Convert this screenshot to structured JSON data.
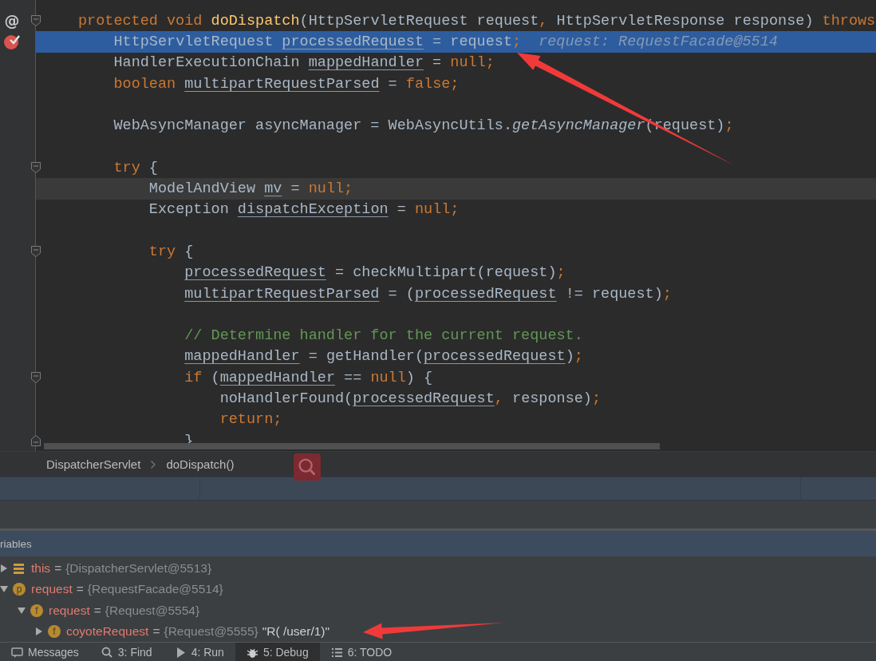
{
  "editor": {
    "lines": [
      {
        "gutter_mark": "@",
        "breakpoint": false,
        "fold_start": true,
        "fold_end": false,
        "execution": false,
        "caret_line": false,
        "tokens": [
          {
            "kind": "kw",
            "text": "protected void "
          },
          {
            "kind": "decl",
            "text": "doDispatch"
          },
          {
            "kind": "txt",
            "text": "(HttpServletRequest request"
          },
          {
            "kind": "kw",
            "text": ", "
          },
          {
            "kind": "txt",
            "text": "HttpServletResponse response) "
          },
          {
            "kind": "kw",
            "text": "throws"
          }
        ]
      },
      {
        "breakpoint": true,
        "fold_start": false,
        "fold_end": false,
        "execution": true,
        "caret_line": false,
        "tokens": [
          {
            "kind": "txt",
            "text": "    HttpServletRequest "
          },
          {
            "kind": "var",
            "text": "processedRequest"
          },
          {
            "kind": "txt",
            "text": " = request"
          },
          {
            "kind": "kw",
            "text": ";"
          }
        ],
        "hint": "request: RequestFacade@5514"
      },
      {
        "breakpoint": false,
        "fold_start": false,
        "fold_end": false,
        "execution": false,
        "caret_line": false,
        "tokens": [
          {
            "kind": "txt",
            "text": "    HandlerExecutionChain "
          },
          {
            "kind": "var",
            "text": "mappedHandler"
          },
          {
            "kind": "txt",
            "text": " = "
          },
          {
            "kind": "kw",
            "text": "null;"
          }
        ]
      },
      {
        "breakpoint": false,
        "fold_start": false,
        "fold_end": false,
        "execution": false,
        "caret_line": false,
        "tokens": [
          {
            "kind": "kw",
            "text": "    boolean "
          },
          {
            "kind": "var",
            "text": "multipartRequestParsed"
          },
          {
            "kind": "txt",
            "text": " = "
          },
          {
            "kind": "kw",
            "text": "false;"
          }
        ]
      },
      {
        "breakpoint": false,
        "fold_start": false,
        "fold_end": false,
        "execution": false,
        "caret_line": false
      },
      {
        "breakpoint": false,
        "fold_start": false,
        "fold_end": false,
        "execution": false,
        "caret_line": false,
        "tokens": [
          {
            "kind": "txt",
            "text": "    WebAsyncManager asyncManager = WebAsyncUtils."
          },
          {
            "kind": "italic",
            "text": "getAsyncManager"
          },
          {
            "kind": "txt",
            "text": "(request)"
          },
          {
            "kind": "kw",
            "text": ";"
          }
        ]
      },
      {
        "breakpoint": false,
        "fold_start": false,
        "fold_end": false,
        "execution": false,
        "caret_line": false
      },
      {
        "breakpoint": false,
        "fold_start": true,
        "fold_end": false,
        "execution": false,
        "caret_line": false,
        "tokens": [
          {
            "kind": "kw",
            "text": "    try "
          },
          {
            "kind": "txt",
            "text": "{"
          }
        ]
      },
      {
        "breakpoint": false,
        "fold_start": false,
        "fold_end": false,
        "execution": false,
        "caret_line": true,
        "tokens": [
          {
            "kind": "txt",
            "text": "        ModelAndView "
          },
          {
            "kind": "var",
            "text": "mv"
          },
          {
            "kind": "txt",
            "text": " = "
          },
          {
            "kind": "kw",
            "text": "null;"
          }
        ]
      },
      {
        "breakpoint": false,
        "fold_start": false,
        "fold_end": false,
        "execution": false,
        "caret_line": false,
        "tokens": [
          {
            "kind": "txt",
            "text": "        Exception "
          },
          {
            "kind": "var",
            "text": "dispatchException"
          },
          {
            "kind": "txt",
            "text": " = "
          },
          {
            "kind": "kw",
            "text": "null;"
          }
        ]
      },
      {
        "breakpoint": false,
        "fold_start": false,
        "fold_end": false,
        "execution": false,
        "caret_line": false
      },
      {
        "breakpoint": false,
        "fold_start": true,
        "fold_end": false,
        "execution": false,
        "caret_line": false,
        "tokens": [
          {
            "kind": "kw",
            "text": "        try "
          },
          {
            "kind": "txt",
            "text": "{"
          }
        ]
      },
      {
        "breakpoint": false,
        "fold_start": false,
        "fold_end": false,
        "execution": false,
        "caret_line": false,
        "tokens": [
          {
            "kind": "var",
            "text": "            processedRequest"
          },
          {
            "kind": "txt",
            "text": " = checkMultipart(request)"
          },
          {
            "kind": "kw",
            "text": ";"
          }
        ]
      },
      {
        "breakpoint": false,
        "fold_start": false,
        "fold_end": false,
        "execution": false,
        "caret_line": false,
        "tokens": [
          {
            "kind": "var",
            "text": "            multipartRequestParsed"
          },
          {
            "kind": "txt",
            "text": " = ("
          },
          {
            "kind": "var",
            "text": "processedRequest"
          },
          {
            "kind": "txt",
            "text": " != request)"
          },
          {
            "kind": "kw",
            "text": ";"
          }
        ]
      },
      {
        "breakpoint": false,
        "fold_start": false,
        "fold_end": false,
        "execution": false,
        "caret_line": false
      },
      {
        "breakpoint": false,
        "fold_start": false,
        "fold_end": false,
        "execution": false,
        "caret_line": false,
        "tokens": [
          {
            "kind": "comment",
            "text": "            // Determine handler for the current request."
          }
        ]
      },
      {
        "breakpoint": false,
        "fold_start": false,
        "fold_end": false,
        "execution": false,
        "caret_line": false,
        "tokens": [
          {
            "kind": "var",
            "text": "            mappedHandler"
          },
          {
            "kind": "txt",
            "text": " = getHandler("
          },
          {
            "kind": "var",
            "text": "processedRequest"
          },
          {
            "kind": "txt",
            "text": ")"
          },
          {
            "kind": "kw",
            "text": ";"
          }
        ]
      },
      {
        "breakpoint": false,
        "fold_start": true,
        "fold_end": false,
        "execution": false,
        "caret_line": false,
        "tokens": [
          {
            "kind": "kw",
            "text": "            if "
          },
          {
            "kind": "txt",
            "text": "("
          },
          {
            "kind": "var",
            "text": "mappedHandler"
          },
          {
            "kind": "txt",
            "text": " == "
          },
          {
            "kind": "kw",
            "text": "null"
          },
          {
            "kind": "txt",
            "text": ") {"
          }
        ]
      },
      {
        "breakpoint": false,
        "fold_start": false,
        "fold_end": false,
        "execution": false,
        "caret_line": false,
        "tokens": [
          {
            "kind": "txt",
            "text": "                noHandlerFound("
          },
          {
            "kind": "var",
            "text": "processedRequest"
          },
          {
            "kind": "kw",
            "text": ", "
          },
          {
            "kind": "txt",
            "text": "response)"
          },
          {
            "kind": "kw",
            "text": ";"
          }
        ]
      },
      {
        "breakpoint": false,
        "fold_start": false,
        "fold_end": false,
        "execution": false,
        "caret_line": false,
        "tokens": [
          {
            "kind": "kw",
            "text": "                return;"
          }
        ]
      },
      {
        "breakpoint": false,
        "fold_start": false,
        "fold_end": true,
        "execution": false,
        "caret_line": false,
        "tokens": [
          {
            "kind": "txt",
            "text": "            }"
          }
        ]
      }
    ]
  },
  "breadcrumb": [
    "DispatcherServlet",
    "doDispatch()"
  ],
  "variables": {
    "title": "riables",
    "items": [
      {
        "kind": "object",
        "name": "this",
        "operator": "=",
        "value": "{DispatcherServlet@5513}",
        "expanded": false
      },
      {
        "kind": "parameter",
        "badge": "p",
        "name": "request",
        "operator": "=",
        "value": "{RequestFacade@5514}",
        "expanded": true,
        "children": [
          {
            "kind": "field",
            "badge": "f",
            "name": "request",
            "operator": "=",
            "value": "{Request@5554}",
            "expanded": true,
            "children": [
              {
                "kind": "field",
                "badge": "f",
                "name": "coyoteRequest",
                "operator": "=",
                "value": "{Request@5555}",
                "string": "\"R( /user/1)\"",
                "expanded": false
              }
            ]
          }
        ]
      }
    ]
  },
  "tool_tabs": [
    {
      "kind": "messages",
      "label": "Messages",
      "selected": false
    },
    {
      "kind": "find",
      "label": "3: Find",
      "selected": false
    },
    {
      "kind": "run",
      "label": "4: Run",
      "selected": false
    },
    {
      "kind": "debug",
      "label": "5: Debug",
      "selected": true
    },
    {
      "kind": "todo",
      "label": "6: TODO",
      "selected": false
    }
  ]
}
